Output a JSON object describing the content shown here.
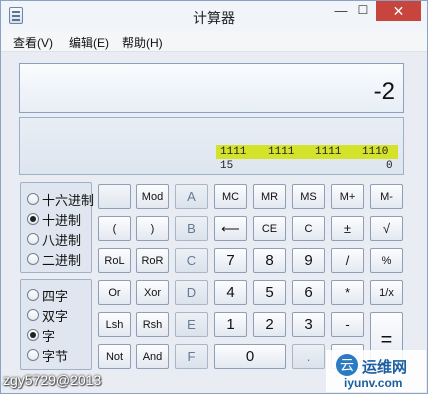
{
  "window": {
    "title": "计算器"
  },
  "titlebar": {
    "minimize": "—",
    "maximize": "☐",
    "close": "✕"
  },
  "menu": [
    "查看(V)",
    "编辑(E)",
    "帮助(H)"
  ],
  "display": {
    "value": "-2"
  },
  "binary": {
    "groups": [
      "1111",
      "1111",
      "1111",
      "1110"
    ],
    "left_index": "15",
    "right_index": "0"
  },
  "base_options": [
    {
      "label": "十六进制",
      "selected": false
    },
    {
      "label": "十进制",
      "selected": true
    },
    {
      "label": "八进制",
      "selected": false
    },
    {
      "label": "二进制",
      "selected": false
    }
  ],
  "word_size_options": [
    {
      "label": "四字",
      "selected": false
    },
    {
      "label": "双字",
      "selected": false
    },
    {
      "label": "字",
      "selected": true
    },
    {
      "label": "字节",
      "selected": false
    }
  ],
  "keys": {
    "mod": "Mod",
    "a": "A",
    "mc": "MC",
    "mr": "MR",
    "ms": "MS",
    "mplus": "M+",
    "mminus": "M-",
    "lparen": "(",
    "rparen": ")",
    "b": "B",
    "backspace": "⟵",
    "ce": "CE",
    "c": "C",
    "plusminus": "±",
    "sqrt": "√",
    "rol": "RoL",
    "ror": "RoR",
    "cc": "C",
    "n7": "7",
    "n8": "8",
    "n9": "9",
    "div": "/",
    "pct": "%",
    "or": "Or",
    "xor": "Xor",
    "d": "D",
    "n4": "4",
    "n5": "5",
    "n6": "6",
    "mul": "*",
    "recip": "1/x",
    "lsh": "Lsh",
    "rsh": "Rsh",
    "e": "E",
    "n1": "1",
    "n2": "2",
    "n3": "3",
    "sub": "-",
    "eq": "=",
    "not": "Not",
    "and": "And",
    "f": "F",
    "n0": "0",
    "dot": ".",
    "add": "+"
  },
  "watermark": {
    "text": "zgy5729@2013",
    "logo_cn": "运维网",
    "logo_url": "iyunv.com",
    "logo_icon": "云"
  }
}
